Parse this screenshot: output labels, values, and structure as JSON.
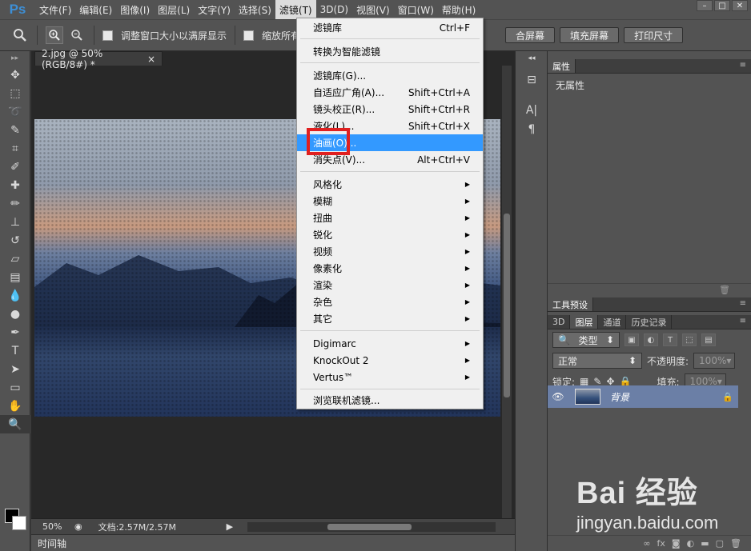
{
  "app": {
    "logo": "Ps",
    "menus": [
      "文件(F)",
      "编辑(E)",
      "图像(I)",
      "图层(L)",
      "文字(Y)",
      "选择(S)",
      "滤镜(T)",
      "3D(D)",
      "视图(V)",
      "窗口(W)",
      "帮助(H)"
    ],
    "active_menu": "滤镜(T)"
  },
  "options": {
    "resize_window_label": "调整窗口大小以满屏显示",
    "zoom_all_label": "缩放所有",
    "fit_screen_label": "合屏幕",
    "fill_screen_label": "填充屏幕",
    "print_size_label": "打印尺寸"
  },
  "document": {
    "tab_title": "2.jpg @ 50%(RGB/8#) *",
    "close_glyph": "×",
    "zoom": "50%",
    "doc_info": "文档:2.57M/2.57M"
  },
  "timeline_label": "时间轴",
  "filter_menu": {
    "items": [
      {
        "label": "滤镜库",
        "shortcut": "Ctrl+F"
      },
      {
        "label": "转换为智能滤镜",
        "shortcut": ""
      },
      {
        "label": "滤镜库(G)...",
        "shortcut": ""
      },
      {
        "label": "自适应广角(A)...",
        "shortcut": "Shift+Ctrl+A"
      },
      {
        "label": "镜头校正(R)...",
        "shortcut": "Shift+Ctrl+R"
      },
      {
        "label": "液化(L)...",
        "shortcut": "Shift+Ctrl+X"
      },
      {
        "label": "油画(O)...",
        "shortcut": ""
      },
      {
        "label": "消失点(V)...",
        "shortcut": "Alt+Ctrl+V"
      },
      {
        "label": "风格化",
        "shortcut": ""
      },
      {
        "label": "模糊",
        "shortcut": ""
      },
      {
        "label": "扭曲",
        "shortcut": ""
      },
      {
        "label": "锐化",
        "shortcut": ""
      },
      {
        "label": "视频",
        "shortcut": ""
      },
      {
        "label": "像素化",
        "shortcut": ""
      },
      {
        "label": "渲染",
        "shortcut": ""
      },
      {
        "label": "杂色",
        "shortcut": ""
      },
      {
        "label": "其它",
        "shortcut": ""
      },
      {
        "label": "Digimarc",
        "shortcut": ""
      },
      {
        "label": "KnockOut 2",
        "shortcut": ""
      },
      {
        "label": "Vertus™",
        "shortcut": ""
      },
      {
        "label": "浏览联机滤镜...",
        "shortcut": ""
      }
    ],
    "highlighted": "油画(O)..."
  },
  "properties_panel": {
    "tab": "属性",
    "empty_text": "无属性"
  },
  "tool_presets_tab": "工具预设",
  "layers_panel": {
    "tabs": [
      "3D",
      "图层",
      "通道",
      "历史记录"
    ],
    "active_tab": "图层",
    "filter_kind": "类型",
    "blend_mode": "正常",
    "opacity_label": "不透明度:",
    "opacity_value": "100%",
    "lock_label": "锁定:",
    "fill_label": "填充:",
    "fill_value": "100%",
    "layer_name": "背景"
  },
  "watermark": {
    "text": "Bai 经验",
    "url": "jingyan.baidu.com"
  },
  "colors": {
    "highlight": "#3399ff",
    "callout": "#e02020",
    "layer_selected": "#6b7fa6"
  }
}
